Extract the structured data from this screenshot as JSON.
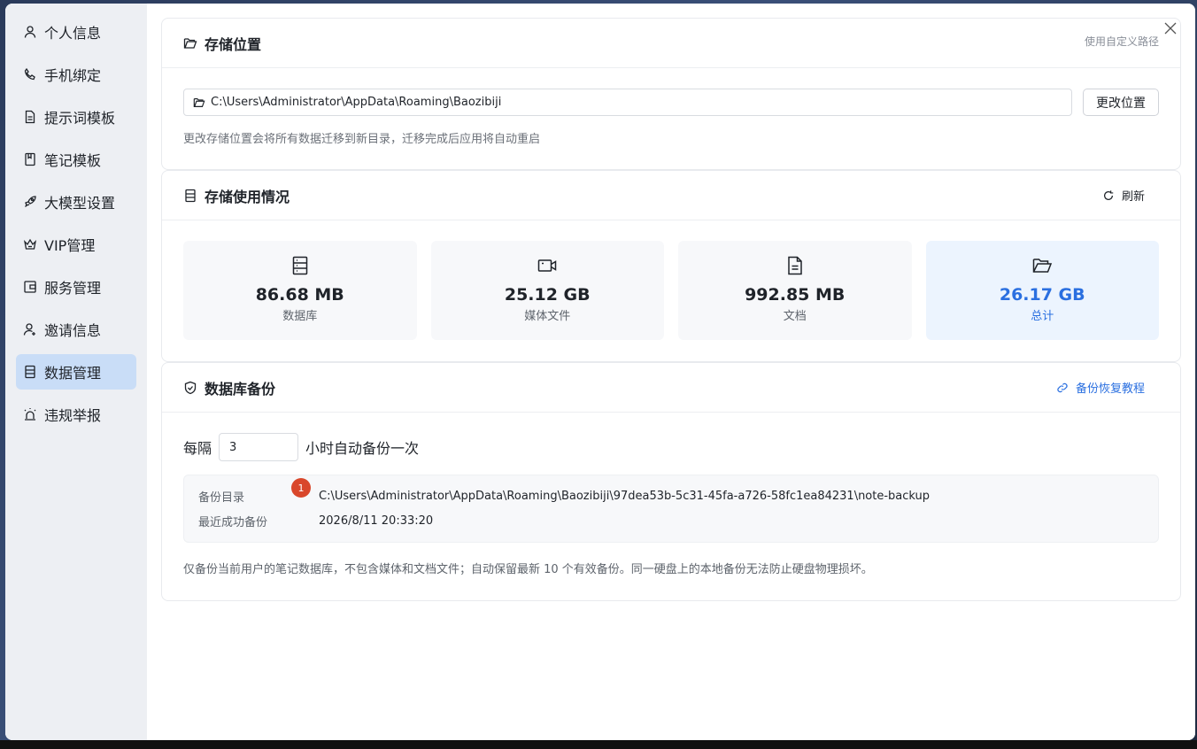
{
  "sidebar": {
    "items": [
      {
        "label": "个人信息",
        "icon": "user-icon"
      },
      {
        "label": "手机绑定",
        "icon": "phone-icon"
      },
      {
        "label": "提示词模板",
        "icon": "document-icon"
      },
      {
        "label": "笔记模板",
        "icon": "notebook-icon"
      },
      {
        "label": "大模型设置",
        "icon": "rocket-icon"
      },
      {
        "label": "VIP管理",
        "icon": "crown-icon"
      },
      {
        "label": "服务管理",
        "icon": "wallet-icon"
      },
      {
        "label": "邀请信息",
        "icon": "user-plus-icon"
      },
      {
        "label": "数据管理",
        "icon": "database-icon",
        "active": true
      },
      {
        "label": "违规举报",
        "icon": "alarm-icon"
      }
    ]
  },
  "storage": {
    "title": "存储位置",
    "custom_path_link": "使用自定义路径",
    "path_value": "C:\\Users\\Administrator\\AppData\\Roaming\\Baozibiji",
    "change_button": "更改位置",
    "hint": "更改存储位置会将所有数据迁移到新目录，迁移完成后应用将自动重启"
  },
  "usage": {
    "title": "存储使用情况",
    "refresh_label": "刷新",
    "stats": [
      {
        "value": "86.68 MB",
        "label": "数据库",
        "icon": "database-icon"
      },
      {
        "value": "25.12 GB",
        "label": "媒体文件",
        "icon": "video-icon"
      },
      {
        "value": "992.85 MB",
        "label": "文档",
        "icon": "file-icon"
      },
      {
        "value": "26.17 GB",
        "label": "总计",
        "icon": "folder-open-icon"
      }
    ]
  },
  "backup": {
    "title": "数据库备份",
    "tutorial_link": "备份恢复教程",
    "interval_prefix": "每隔",
    "interval_value": "3",
    "interval_suffix": "小时自动备份一次",
    "dir_label": "备份目录",
    "dir_value": "C:\\Users\\Administrator\\AppData\\Roaming\\Baozibiji\\97dea53b-5c31-45fa-a726-58fc1ea84231\\note-backup",
    "last_label": "最近成功备份",
    "last_value": "2026/8/11 20:33:20",
    "badge_count": "1",
    "note": "仅备份当前用户的笔记数据库，不包含媒体和文档文件；自动保留最新 10 个有效备份。同一硬盘上的本地备份无法防止硬盘物理损坏。"
  },
  "colors": {
    "accent": "#2a6fe0",
    "badge": "#d9472b",
    "sidebar_active": "#c9ddf7"
  }
}
